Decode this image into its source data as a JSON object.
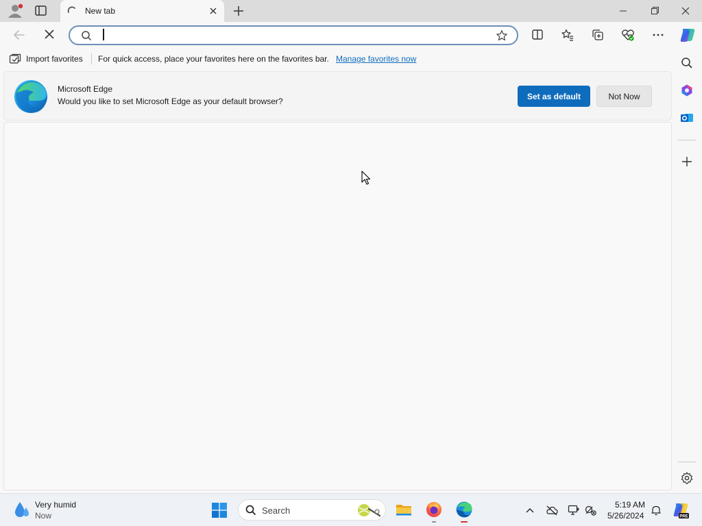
{
  "window": {
    "tab_title": "New tab",
    "controls": [
      "minimize",
      "restore",
      "close"
    ]
  },
  "toolbar": {
    "address_value": "",
    "address_placeholder": "",
    "icons": [
      "back-icon",
      "stop-loading-icon",
      "search-icon",
      "favorite-star-icon",
      "split-screen-icon",
      "favorites-icon",
      "collections-icon",
      "browser-essentials-icon",
      "more-icon",
      "copilot-icon"
    ]
  },
  "favorites_bar": {
    "import_label": "Import favorites",
    "message": "For quick access, place your favorites here on the favorites bar.",
    "link": "Manage favorites now"
  },
  "infobar": {
    "title": "Microsoft Edge",
    "message": "Would you like to set Microsoft Edge as your default browser?",
    "primary_button": "Set as default",
    "secondary_button": "Not Now"
  },
  "sidebar": {
    "icons": [
      "search-icon",
      "microsoft-365-icon",
      "outlook-icon",
      "add-icon",
      "settings-icon"
    ]
  },
  "taskbar": {
    "weather_main": "Very humid",
    "weather_sub": "Now",
    "search_label": "Search",
    "apps": [
      "file-explorer-icon",
      "firefox-icon",
      "edge-icon"
    ],
    "clock_time": "5:19 AM",
    "clock_date": "5/26/2024"
  },
  "colors": {
    "accent": "#0f6cbd",
    "tabstrip": "#dcdcdc",
    "notification_dot": "#d13438"
  }
}
